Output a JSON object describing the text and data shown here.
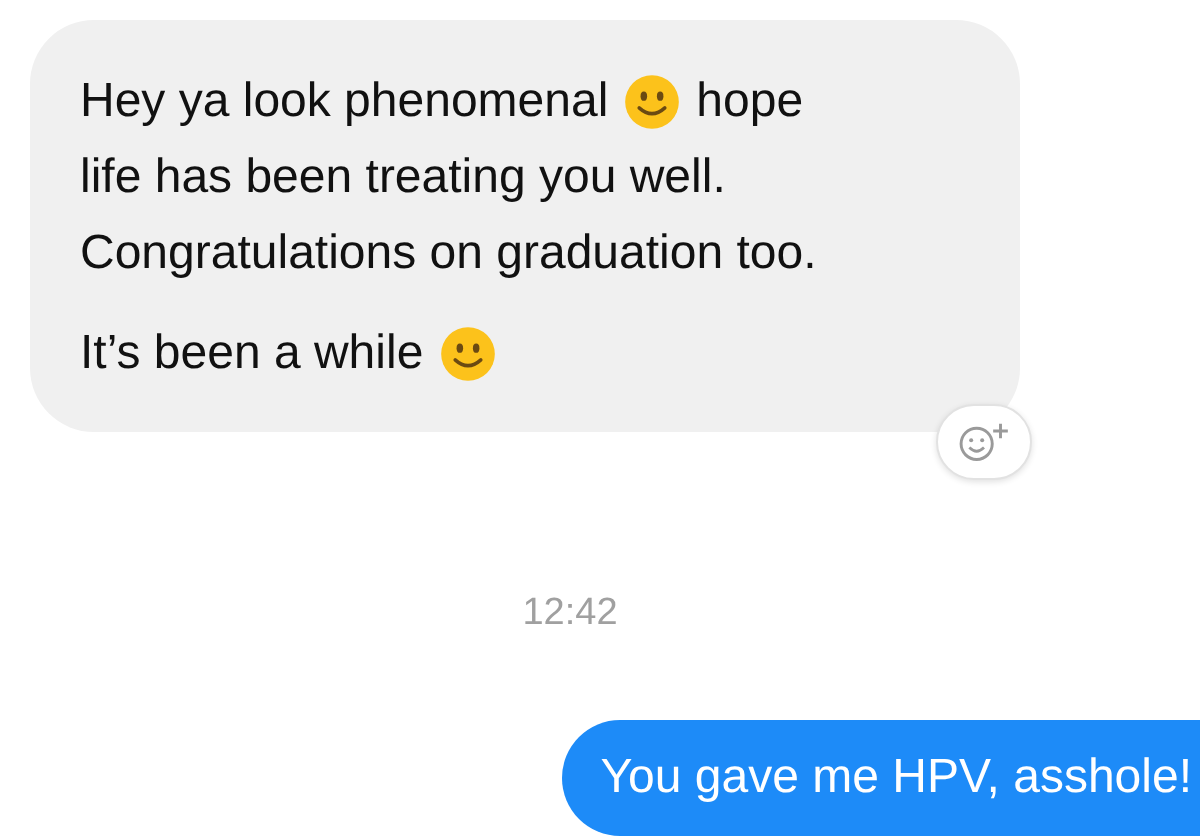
{
  "incoming_message": {
    "paragraphs": [
      [
        [
          {
            "kind": "text",
            "text": "Hey ya look phenomenal"
          },
          {
            "kind": "emoji"
          },
          {
            "kind": "text",
            "text": "hope"
          }
        ],
        [
          {
            "kind": "text",
            "text": "life has been treating you well."
          }
        ],
        [
          {
            "kind": "text",
            "text": "Congratulations on graduation too."
          }
        ]
      ],
      [
        [
          {
            "kind": "text",
            "text": "It’s been a while"
          },
          {
            "kind": "emoji"
          }
        ]
      ]
    ]
  },
  "timestamp": "12:42",
  "outgoing_message": {
    "text": "You gave me HPV, asshole!"
  }
}
